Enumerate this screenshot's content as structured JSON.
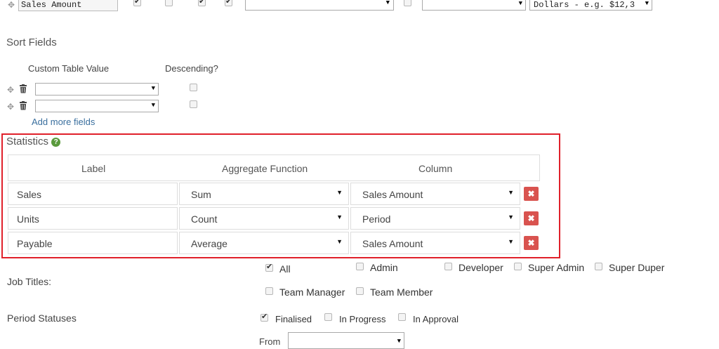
{
  "top_row": {
    "field_value": "Sales Amount",
    "format_select": "Dollars - e.g. $12,3",
    "checkboxes": [
      true,
      false,
      true,
      true
    ],
    "extra_checkbox": false
  },
  "sort_fields": {
    "heading": "Sort Fields",
    "col_value": "Custom Table Value",
    "col_desc": "Descending?",
    "add_more": "Add more fields"
  },
  "statistics": {
    "heading": "Statistics",
    "col_label": "Label",
    "col_agg": "Aggregate Function",
    "col_column": "Column",
    "rows": [
      {
        "label": "Sales",
        "agg": "Sum",
        "column": "Sales Amount"
      },
      {
        "label": "Units",
        "agg": "Count",
        "column": "Period"
      },
      {
        "label": "Payable",
        "agg": "Average",
        "column": "Sales Amount"
      }
    ],
    "delete_glyph": "✖"
  },
  "job_titles": {
    "label": "Job Titles:",
    "options": [
      {
        "label": "All",
        "checked": true
      },
      {
        "label": "Admin",
        "checked": false
      },
      {
        "label": "Developer",
        "checked": false
      },
      {
        "label": "Super Admin",
        "checked": false
      },
      {
        "label": "Super Duper",
        "checked": false
      },
      {
        "label": "Team Manager",
        "checked": false
      },
      {
        "label": "Team Member",
        "checked": false
      }
    ]
  },
  "period_statuses": {
    "label": "Period Statuses",
    "options": [
      {
        "label": "Finalised",
        "checked": true
      },
      {
        "label": "In Progress",
        "checked": false
      },
      {
        "label": "In Approval",
        "checked": false
      }
    ]
  },
  "from": {
    "label": "From"
  }
}
